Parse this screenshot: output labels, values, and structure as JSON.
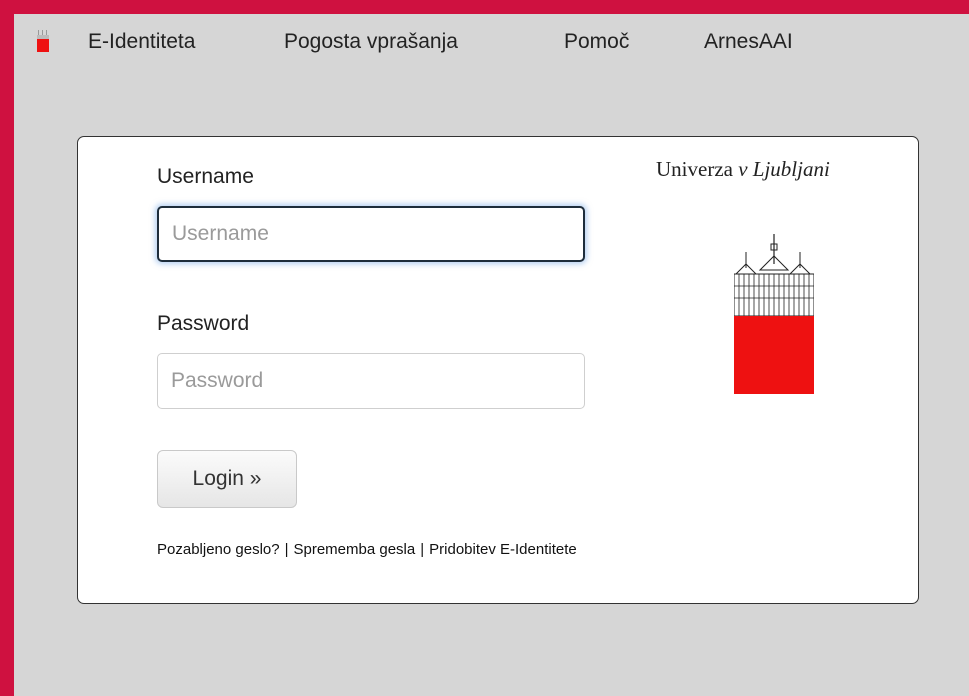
{
  "nav": {
    "items": [
      {
        "label": "E-Identiteta"
      },
      {
        "label": "Pogosta vprašanja"
      },
      {
        "label": "Pomoč"
      },
      {
        "label": "ArnesAAI"
      }
    ]
  },
  "login": {
    "username_label": "Username",
    "username_placeholder": "Username",
    "password_label": "Password",
    "password_placeholder": "Password",
    "login_button": "Login »",
    "links": [
      {
        "label": "Pozabljeno geslo?"
      },
      {
        "label": "Sprememba gesla"
      },
      {
        "label": "Pridobitev E-Identitete"
      }
    ],
    "separator": "|"
  },
  "university": {
    "name_regular": "Univerza ",
    "name_italic": "v Ljubljani",
    "logo_color": "#ee1111"
  },
  "colors": {
    "brand_red": "#cf1140",
    "page_bg": "#d6d6d6"
  }
}
